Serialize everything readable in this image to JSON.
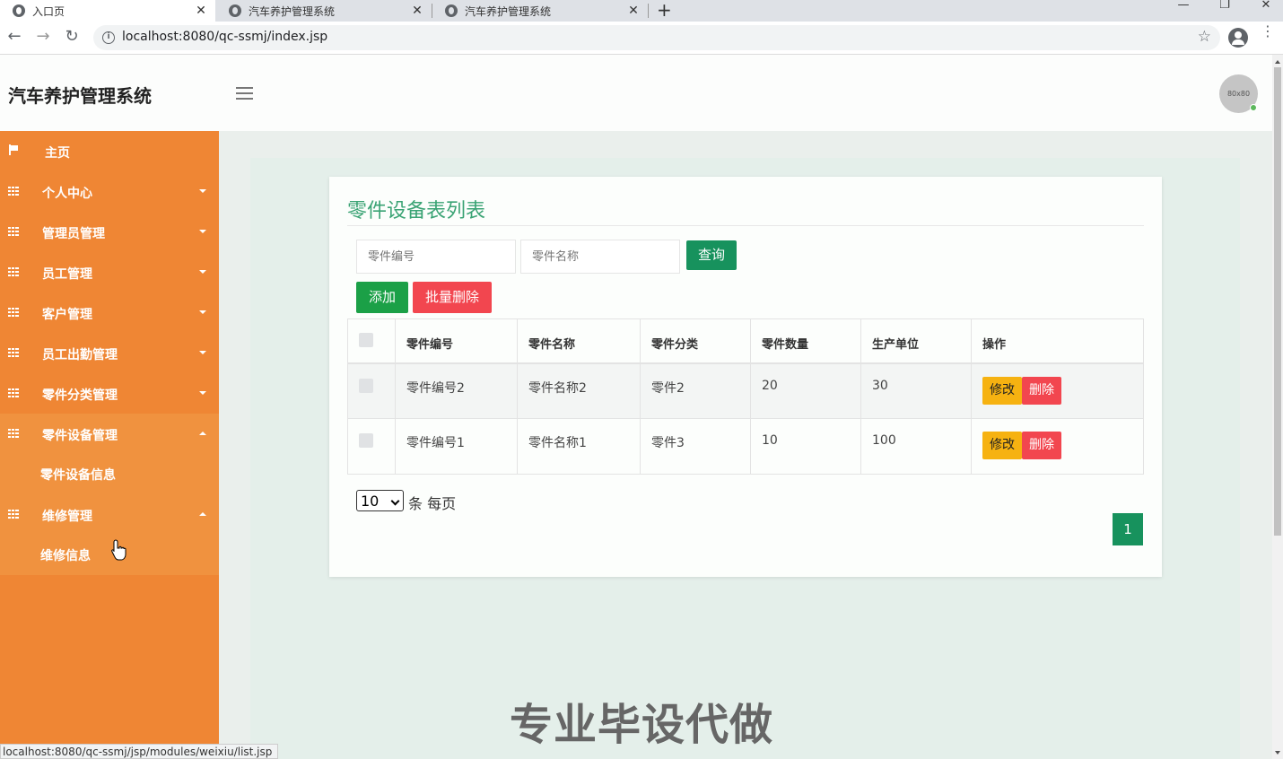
{
  "browser": {
    "tabs": [
      {
        "label": "入口页",
        "close": "✕"
      },
      {
        "label": "汽车养护管理系统",
        "close": "✕"
      },
      {
        "label": "汽车养护管理系统",
        "close": "✕"
      }
    ],
    "new_tab": "+",
    "url": "localhost:8080/qc-ssmj/index.jsp",
    "status_url": "localhost:8080/qc-ssmj/jsp/modules/weixiu/list.jsp",
    "controls": {
      "minimize": "—",
      "restore": "❐",
      "close": "✕",
      "back": "←",
      "forward": "→",
      "reload": "↻",
      "star": "☆",
      "info": "i",
      "kebab": "⋮"
    }
  },
  "header": {
    "title": "汽车养护管理系统",
    "avatar_text": "80x80"
  },
  "sidebar": {
    "items": [
      {
        "label": "主页",
        "icon": "flag-icon"
      },
      {
        "label": "个人中心",
        "icon": "grid-icon"
      },
      {
        "label": "管理员管理",
        "icon": "grid-icon"
      },
      {
        "label": "员工管理",
        "icon": "grid-icon"
      },
      {
        "label": "客户管理",
        "icon": "grid-icon"
      },
      {
        "label": "员工出勤管理",
        "icon": "grid-icon"
      },
      {
        "label": "零件分类管理",
        "icon": "grid-icon"
      },
      {
        "label": "零件设备管理",
        "icon": "grid-icon",
        "open": true,
        "sub": "零件设备信息"
      },
      {
        "label": "维修管理",
        "icon": "grid-icon",
        "open": true,
        "sub": "维修信息"
      }
    ],
    "bg_color": "#ef8634"
  },
  "main": {
    "title": "零件设备表列表",
    "search": {
      "code_placeholder": "零件编号",
      "name_placeholder": "零件名称",
      "query_label": "查询"
    },
    "actions": {
      "add_label": "添加",
      "batch_delete_label": "批量删除"
    },
    "table": {
      "headers": [
        "零件编号",
        "零件名称",
        "零件分类",
        "零件数量",
        "生产单位",
        "操作"
      ],
      "rows": [
        {
          "code": "零件编号2",
          "name": "零件名称2",
          "category": "零件2",
          "quantity": "20",
          "unit": "30"
        },
        {
          "code": "零件编号1",
          "name": "零件名称1",
          "category": "零件3",
          "quantity": "10",
          "unit": "100"
        }
      ],
      "edit_label": "修改",
      "delete_label": "删除"
    },
    "pagination": {
      "page_size": "10",
      "per_page_label": "条 每页",
      "current_page": "1"
    }
  },
  "watermark": "专业毕设代做",
  "colors": {
    "accent_green": "#17925d",
    "title_green": "#3aa374",
    "danger": "#f2464f",
    "warning": "#f6b211"
  }
}
